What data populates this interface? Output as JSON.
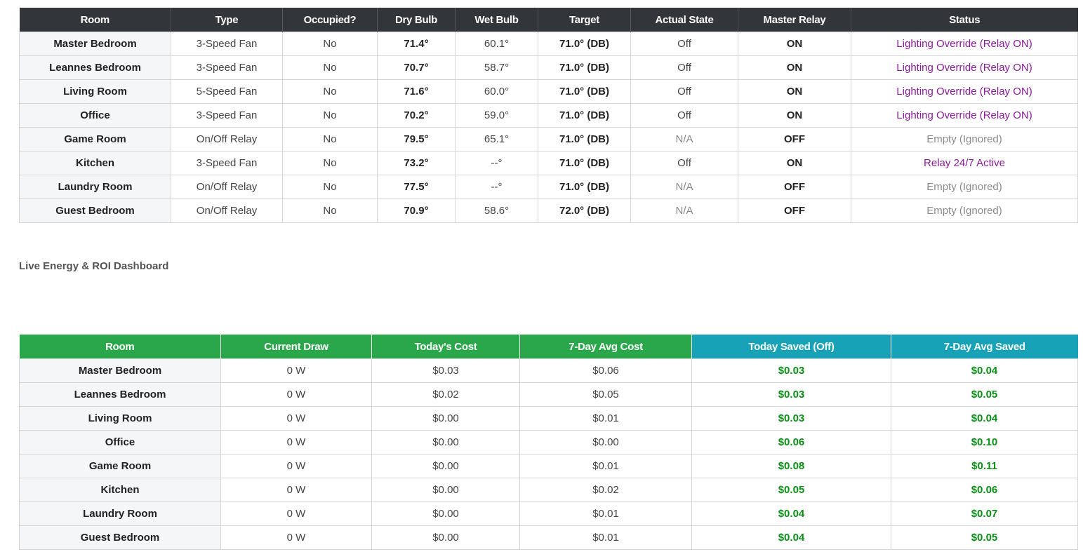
{
  "rooms_table": {
    "headers": [
      "Room",
      "Type",
      "Occupied?",
      "Dry Bulb",
      "Wet Bulb",
      "Target",
      "Actual State",
      "Master Relay",
      "Status"
    ],
    "rows": [
      {
        "room": "Master Bedroom",
        "type": "3-Speed Fan",
        "occupied": "No",
        "dry_bulb": "71.4°",
        "wet_bulb": "60.1°",
        "target": "71.0° (DB)",
        "actual_state": "Off",
        "master_relay": "ON",
        "status": "Lighting Override (Relay ON)"
      },
      {
        "room": "Leannes Bedroom",
        "type": "3-Speed Fan",
        "occupied": "No",
        "dry_bulb": "70.7°",
        "wet_bulb": "58.7°",
        "target": "71.0° (DB)",
        "actual_state": "Off",
        "master_relay": "ON",
        "status": "Lighting Override (Relay ON)"
      },
      {
        "room": "Living Room",
        "type": "5-Speed Fan",
        "occupied": "No",
        "dry_bulb": "71.6°",
        "wet_bulb": "60.0°",
        "target": "71.0° (DB)",
        "actual_state": "Off",
        "master_relay": "ON",
        "status": "Lighting Override (Relay ON)"
      },
      {
        "room": "Office",
        "type": "3-Speed Fan",
        "occupied": "No",
        "dry_bulb": "70.2°",
        "wet_bulb": "59.0°",
        "target": "71.0° (DB)",
        "actual_state": "Off",
        "master_relay": "ON",
        "status": "Lighting Override (Relay ON)"
      },
      {
        "room": "Game Room",
        "type": "On/Off Relay",
        "occupied": "No",
        "dry_bulb": "79.5°",
        "wet_bulb": "65.1°",
        "target": "71.0° (DB)",
        "actual_state": "N/A",
        "master_relay": "OFF",
        "status": "Empty (Ignored)"
      },
      {
        "room": "Kitchen",
        "type": "3-Speed Fan",
        "occupied": "No",
        "dry_bulb": "73.2°",
        "wet_bulb": "--°",
        "target": "71.0° (DB)",
        "actual_state": "Off",
        "master_relay": "ON",
        "status": "Relay 24/7 Active"
      },
      {
        "room": "Laundry Room",
        "type": "On/Off Relay",
        "occupied": "No",
        "dry_bulb": "77.5°",
        "wet_bulb": "--°",
        "target": "71.0° (DB)",
        "actual_state": "N/A",
        "master_relay": "OFF",
        "status": "Empty (Ignored)"
      },
      {
        "room": "Guest Bedroom",
        "type": "On/Off Relay",
        "occupied": "No",
        "dry_bulb": "70.9°",
        "wet_bulb": "58.6°",
        "target": "72.0° (DB)",
        "actual_state": "N/A",
        "master_relay": "OFF",
        "status": "Empty (Ignored)"
      }
    ]
  },
  "energy_section_title": "Live Energy & ROI Dashboard",
  "energy_table": {
    "headers": [
      "Room",
      "Current Draw",
      "Today's Cost",
      "7-Day Avg Cost",
      "Today Saved (Off)",
      "7-Day Avg Saved"
    ],
    "rows": [
      {
        "room": "Master Bedroom",
        "current_draw": "0 W",
        "todays_cost": "$0.03",
        "avg_cost_7d": "$0.06",
        "today_saved": "$0.03",
        "avg_saved_7d": "$0.04"
      },
      {
        "room": "Leannes Bedroom",
        "current_draw": "0 W",
        "todays_cost": "$0.02",
        "avg_cost_7d": "$0.05",
        "today_saved": "$0.03",
        "avg_saved_7d": "$0.05"
      },
      {
        "room": "Living Room",
        "current_draw": "0 W",
        "todays_cost": "$0.00",
        "avg_cost_7d": "$0.01",
        "today_saved": "$0.03",
        "avg_saved_7d": "$0.04"
      },
      {
        "room": "Office",
        "current_draw": "0 W",
        "todays_cost": "$0.00",
        "avg_cost_7d": "$0.00",
        "today_saved": "$0.06",
        "avg_saved_7d": "$0.10"
      },
      {
        "room": "Game Room",
        "current_draw": "0 W",
        "todays_cost": "$0.00",
        "avg_cost_7d": "$0.01",
        "today_saved": "$0.08",
        "avg_saved_7d": "$0.11"
      },
      {
        "room": "Kitchen",
        "current_draw": "0 W",
        "todays_cost": "$0.00",
        "avg_cost_7d": "$0.02",
        "today_saved": "$0.05",
        "avg_saved_7d": "$0.06"
      },
      {
        "room": "Laundry Room",
        "current_draw": "0 W",
        "todays_cost": "$0.00",
        "avg_cost_7d": "$0.01",
        "today_saved": "$0.04",
        "avg_saved_7d": "$0.07"
      },
      {
        "room": "Guest Bedroom",
        "current_draw": "0 W",
        "todays_cost": "$0.00",
        "avg_cost_7d": "$0.01",
        "today_saved": "$0.04",
        "avg_saved_7d": "$0.05"
      }
    ]
  },
  "colors": {
    "header_dark": "#32363b",
    "header_green": "#2aa74a",
    "header_cyan": "#17a2b8",
    "status_purple": "#8b1a9b",
    "saved_green": "#0a8f17"
  }
}
